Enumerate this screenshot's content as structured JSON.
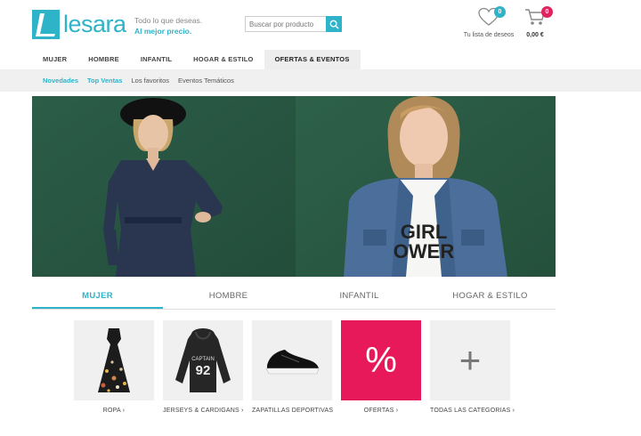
{
  "brand": {
    "logo_text": "lesara",
    "tagline_line1": "Todo lo que deseas.",
    "tagline_line2": "Al mejor precio."
  },
  "search": {
    "placeholder": "Buscar por producto"
  },
  "wishlist": {
    "label": "Tu lista de deseos",
    "count": "0"
  },
  "cart": {
    "total": "0,00 €",
    "count": "0"
  },
  "nav": {
    "items": [
      {
        "label": "MUJER"
      },
      {
        "label": "HOMBRE"
      },
      {
        "label": "INFANTIL"
      },
      {
        "label": "HOGAR & ESTILO"
      },
      {
        "label": "OFERTAS & EVENTOS",
        "active": true
      }
    ]
  },
  "subnav": {
    "items": [
      {
        "label": "Novedades"
      },
      {
        "label": "Top Ventas"
      },
      {
        "label": "Los favoritos"
      },
      {
        "label": "Eventos Temáticos"
      }
    ]
  },
  "hero": {
    "shirt_text_line1": "GIRL",
    "shirt_text_line2": "OWER"
  },
  "category_tabs": [
    {
      "label": "MUJER",
      "active": true
    },
    {
      "label": "HOMBRE"
    },
    {
      "label": "INFANTIL"
    },
    {
      "label": "HOGAR & ESTILO"
    }
  ],
  "tiles": [
    {
      "label": "ROPA",
      "arrow": "›"
    },
    {
      "label": "JERSEYS & CARDIGANS",
      "arrow": "›",
      "print_top": "CAPTAIN",
      "print_number": "92"
    },
    {
      "label": "ZAPATILLAS DEPORTIVAS",
      "arrow": ""
    },
    {
      "label": "OFERTAS",
      "arrow": "›",
      "symbol": "%"
    },
    {
      "label": "TODAS LAS CATEGORIAS",
      "arrow": "›",
      "symbol": "+"
    }
  ],
  "colors": {
    "accent": "#2fb3c8",
    "offer": "#e8195a",
    "hero_bg": "#2a5a45"
  }
}
